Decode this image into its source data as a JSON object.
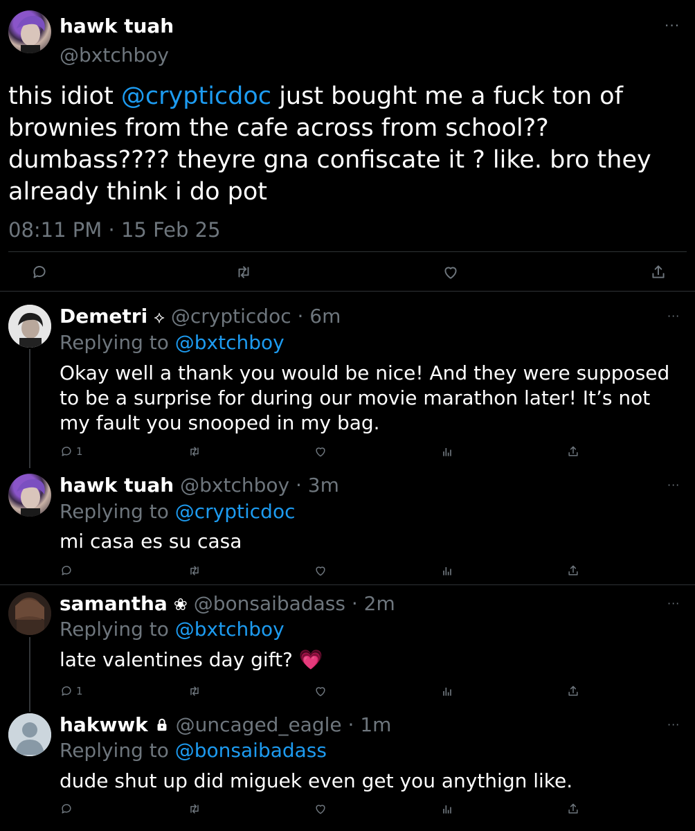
{
  "main_tweet": {
    "display_name": "hawk tuah",
    "handle": "@bxtchboy",
    "text_before": "this idiot ",
    "mention": "@crypticdoc",
    "text_after": " just bought me a fuck ton of brownies from the cafe across from school?? dumbass???? theyre gna confiscate it ? like. bro they already think i do pot",
    "timestamp": "08:11 PM · 15 Feb 25"
  },
  "replies": [
    {
      "display_name": "Demetri",
      "name_badge": "⟡",
      "handle": "@crypticdoc",
      "time": "· 6m",
      "replying_prefix": "Replying to ",
      "replying_to": "@bxtchboy",
      "text": "Okay well a thank you would be nice! And they were supposed to be a surprise for during our movie marathon later! It’s not my fault you snooped in my bag.",
      "reply_count": "1"
    },
    {
      "display_name": "hawk tuah",
      "handle": "@bxtchboy",
      "time": "· 3m",
      "replying_prefix": "Replying to ",
      "replying_to": "@crypticdoc",
      "text": "mi casa es su casa",
      "reply_count": ""
    },
    {
      "display_name": "samantha",
      "name_badge": "❀",
      "handle": "@bonsaibadass",
      "time": "· 2m",
      "replying_prefix": "Replying to ",
      "replying_to": "@bxtchboy",
      "text": "late valentines day gift? 💗",
      "reply_count": "1"
    },
    {
      "display_name": "hakwwk",
      "name_badge": "🔒",
      "handle": "@uncaged_eagle",
      "time": "· 1m",
      "replying_prefix": "Replying to ",
      "replying_to": "@bonsaibadass",
      "text": "dude shut up did miguek even get you anythign like.",
      "reply_count": ""
    }
  ],
  "colors": {
    "background": "#000000",
    "link": "#1d9bf0",
    "muted": "#6e767d"
  },
  "icons": [
    "more-icon",
    "reply-icon",
    "retweet-icon",
    "like-icon",
    "share-icon",
    "analytics-icon",
    "lock-icon",
    "sparkle-icon",
    "flower-icon"
  ]
}
